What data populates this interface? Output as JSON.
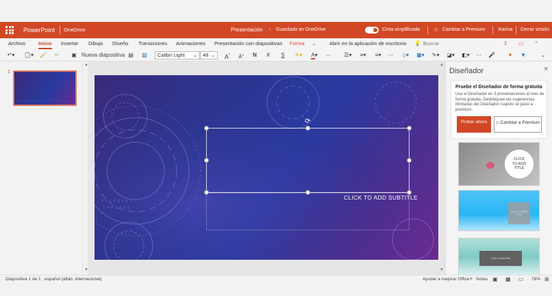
{
  "titlebar": {
    "app_name": "PowerPoint",
    "service": "OneDrive",
    "doc_title": "Presentación",
    "save_status": "Guardado en OneDrive",
    "ribbon_toggle_label": "Cinta simplificada",
    "upgrade_label": "Cambiar a Premium",
    "user_name": "Karina",
    "signout_label": "Cerrar sesión"
  },
  "tabs": [
    "Archivo",
    "Inicio",
    "Insertar",
    "Dibujo",
    "Diseño",
    "Transiciones",
    "Animaciones",
    "Presentación con diapositivas",
    "Forma",
    "Abrir en la aplicación de escritorio",
    "Buscar"
  ],
  "toolbar": {
    "new_slide_label": "Nueva diapositiva",
    "font_name": "Calibri Light",
    "font_size": "48",
    "bold": "N",
    "italic": "K",
    "underline": "S",
    "font_inc": "A",
    "font_dec": "A"
  },
  "thumbnails": [
    {
      "number": "1"
    }
  ],
  "slide": {
    "subtitle_placeholder": "CLICK TO ADD SUBTITLE"
  },
  "designer": {
    "title": "Diseñador",
    "promo_title": "Pruebe el Diseñador de forma gratuita",
    "promo_text": "Use el Diseñador en 3 presentaciones al mes de forma gratuita. Desbloquee las sugerencias ilimitadas del Diseñador cuando se pase a premium.",
    "try_button": "Probar ahora",
    "upgrade_button": "Cambiar a Premium",
    "designs": [
      {
        "line1": "CLICK",
        "line2": "TO ADD",
        "line3": "TITLE"
      },
      {
        "text": "CLICK TO ADD TITLE"
      },
      {
        "text": "Click to add title"
      }
    ]
  },
  "statusbar": {
    "slide_counter": "Diapositiva 1 de 1",
    "language": "español (alfab. internacional)",
    "feedback": "Ayudar a mejorar Office",
    "notes": "Notas",
    "zoom": "78%"
  },
  "colors": {
    "accent": "#d24726",
    "slide_dark": "#2a3190",
    "slide_magenta": "#6a2a90"
  }
}
